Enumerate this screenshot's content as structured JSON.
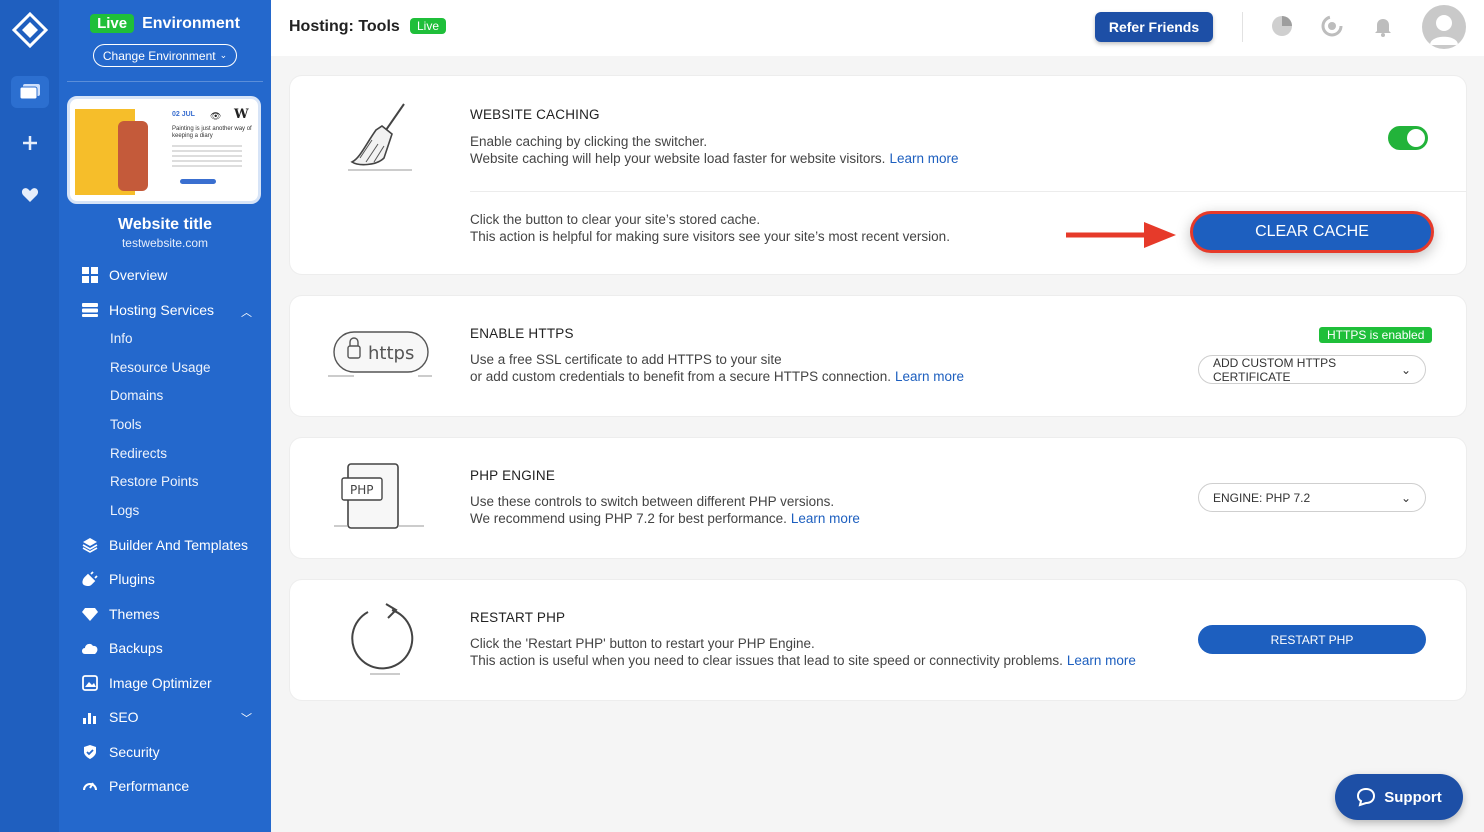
{
  "environment": {
    "badge": "Live",
    "title": "Environment",
    "change_label": "Change Environment"
  },
  "site": {
    "thumbnail": {
      "date": "02 JUL",
      "tagline": "Painting is just another way of keeping a diary"
    },
    "title": "Website title",
    "url": "testwebsite.com"
  },
  "sidebar": {
    "items": [
      {
        "label": "Overview",
        "icon": "grid-icon"
      },
      {
        "label": "Hosting Services",
        "icon": "server-icon"
      },
      {
        "label": "Builder And Templates",
        "icon": "layers-icon"
      },
      {
        "label": "Plugins",
        "icon": "plugin-icon"
      },
      {
        "label": "Themes",
        "icon": "diamond-icon"
      },
      {
        "label": "Backups",
        "icon": "cloud-upload-icon"
      },
      {
        "label": "Image Optimizer",
        "icon": "image-icon"
      },
      {
        "label": "SEO",
        "icon": "bar-chart-icon"
      },
      {
        "label": "Security",
        "icon": "shield-icon"
      },
      {
        "label": "Performance",
        "icon": "gauge-icon"
      }
    ],
    "sub_items": [
      "Info",
      "Resource Usage",
      "Domains",
      "Tools",
      "Redirects",
      "Restore Points",
      "Logs"
    ]
  },
  "header": {
    "title": "Hosting: Tools",
    "badge": "Live",
    "refer_label": "Refer Friends"
  },
  "caching": {
    "title": "WEBSITE CACHING",
    "desc1": "Enable caching by clicking the switcher.",
    "desc2": "Website caching will help your website load faster for website visitors.",
    "learn": "Learn more",
    "toggle_on": true,
    "clear_desc1": "Click the button to clear your site’s stored cache.",
    "clear_desc2": "This action is helpful for making sure visitors see your site’s most recent version.",
    "clear_label": "CLEAR CACHE"
  },
  "https": {
    "title": "ENABLE HTTPS",
    "icon_text": "https",
    "desc1": "Use a free SSL certificate to add HTTPS to your site",
    "desc2": "or add custom credentials to benefit from a secure HTTPS connection.",
    "learn": "Learn more",
    "status": "HTTPS is enabled",
    "button": "ADD CUSTOM HTTPS CERTIFICATE"
  },
  "php": {
    "title": "PHP ENGINE",
    "icon_text": "PHP",
    "desc1": "Use these controls to switch between different PHP versions.",
    "desc2": "We recommend using PHP 7.2 for best performance.",
    "learn": "Learn more",
    "select": "ENGINE: PHP 7.2"
  },
  "restart": {
    "title": "RESTART PHP",
    "desc1": "Click the 'Restart PHP' button to restart your PHP Engine.",
    "desc2": "This action is useful when you need to clear issues that lead to site speed or connectivity problems.",
    "learn": "Learn more",
    "button": "RESTART PHP"
  },
  "support_label": "Support",
  "colors": {
    "sidebar": "#2468cc",
    "rail": "#1f5fbf",
    "live_green": "#1fbf3a",
    "primary": "#1d5fbf",
    "highlight_red": "#e63a2a"
  }
}
